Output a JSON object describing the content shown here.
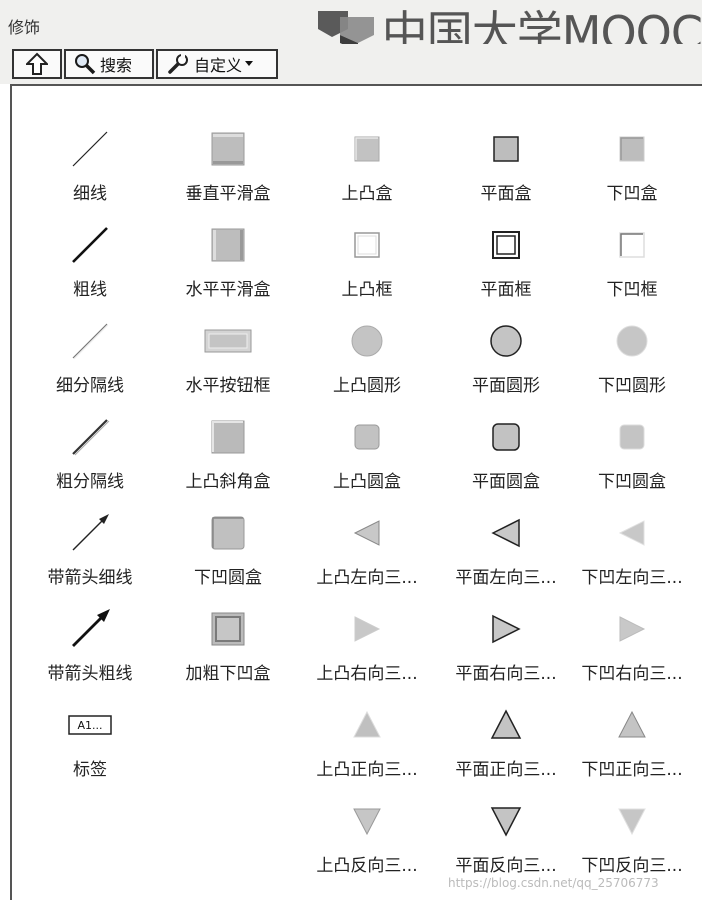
{
  "window": {
    "title": "修饰"
  },
  "watermark": {
    "text": "中国大学MOOC",
    "url": "https://blog.csdn.net/qq_25706773"
  },
  "toolbar": {
    "up_label": "⇧",
    "search_label": "搜索",
    "customize_label": "自定义"
  },
  "icons": {
    "up": "up-arrow-icon",
    "search": "magnifier-icon",
    "customize": "wrench-icon",
    "dropdown": "dropdown-arrow-icon"
  },
  "palette": {
    "columns": [
      [
        {
          "label": "细线",
          "icon": "thin-line-icon"
        },
        {
          "label": "粗线",
          "icon": "thick-line-icon"
        },
        {
          "label": "细分隔线",
          "icon": "thin-separator-icon"
        },
        {
          "label": "粗分隔线",
          "icon": "thick-separator-icon"
        },
        {
          "label": "带箭头细线",
          "icon": "thin-arrow-line-icon"
        },
        {
          "label": "带箭头粗线",
          "icon": "thick-arrow-line-icon"
        },
        {
          "label": "标签",
          "icon": "label-icon",
          "icon_text": "A1..."
        }
      ],
      [
        {
          "label": "垂直平滑盒",
          "icon": "vertical-smooth-box-icon"
        },
        {
          "label": "水平平滑盒",
          "icon": "horizontal-smooth-box-icon"
        },
        {
          "label": "水平按钮框",
          "icon": "horizontal-button-frame-icon"
        },
        {
          "label": "上凸斜角盒",
          "icon": "raised-bevel-box-icon"
        },
        {
          "label": "下凹圆盒",
          "icon": "recessed-rounded-box-icon"
        },
        {
          "label": "加粗下凹盒",
          "icon": "thick-recessed-box-icon"
        }
      ],
      [
        {
          "label": "上凸盒",
          "icon": "raised-box-icon"
        },
        {
          "label": "上凸框",
          "icon": "raised-frame-icon"
        },
        {
          "label": "上凸圆形",
          "icon": "raised-circle-icon"
        },
        {
          "label": "上凸圆盒",
          "icon": "raised-round-box-icon"
        },
        {
          "label": "上凸左向三...",
          "icon": "raised-left-triangle-icon"
        },
        {
          "label": "上凸右向三...",
          "icon": "raised-right-triangle-icon"
        },
        {
          "label": "上凸正向三...",
          "icon": "raised-up-triangle-icon"
        },
        {
          "label": "上凸反向三...",
          "icon": "raised-down-triangle-icon"
        }
      ],
      [
        {
          "label": "平面盒",
          "icon": "flat-box-icon"
        },
        {
          "label": "平面框",
          "icon": "flat-frame-icon"
        },
        {
          "label": "平面圆形",
          "icon": "flat-circle-icon"
        },
        {
          "label": "平面圆盒",
          "icon": "flat-round-box-icon"
        },
        {
          "label": "平面左向三...",
          "icon": "flat-left-triangle-icon"
        },
        {
          "label": "平面右向三...",
          "icon": "flat-right-triangle-icon"
        },
        {
          "label": "平面正向三...",
          "icon": "flat-up-triangle-icon"
        },
        {
          "label": "平面反向三...",
          "icon": "flat-down-triangle-icon"
        }
      ],
      [
        {
          "label": "下凹盒",
          "icon": "recessed-box-icon"
        },
        {
          "label": "下凹框",
          "icon": "recessed-frame-icon"
        },
        {
          "label": "下凹圆形",
          "icon": "recessed-circle-icon"
        },
        {
          "label": "下凹圆盒",
          "icon": "recessed-round-box-icon"
        },
        {
          "label": "下凹左向三...",
          "icon": "recessed-left-triangle-icon"
        },
        {
          "label": "下凹右向三...",
          "icon": "recessed-right-triangle-icon"
        },
        {
          "label": "下凹正向三...",
          "icon": "recessed-up-triangle-icon"
        },
        {
          "label": "下凹反向三...",
          "icon": "recessed-down-triangle-icon"
        }
      ]
    ]
  }
}
